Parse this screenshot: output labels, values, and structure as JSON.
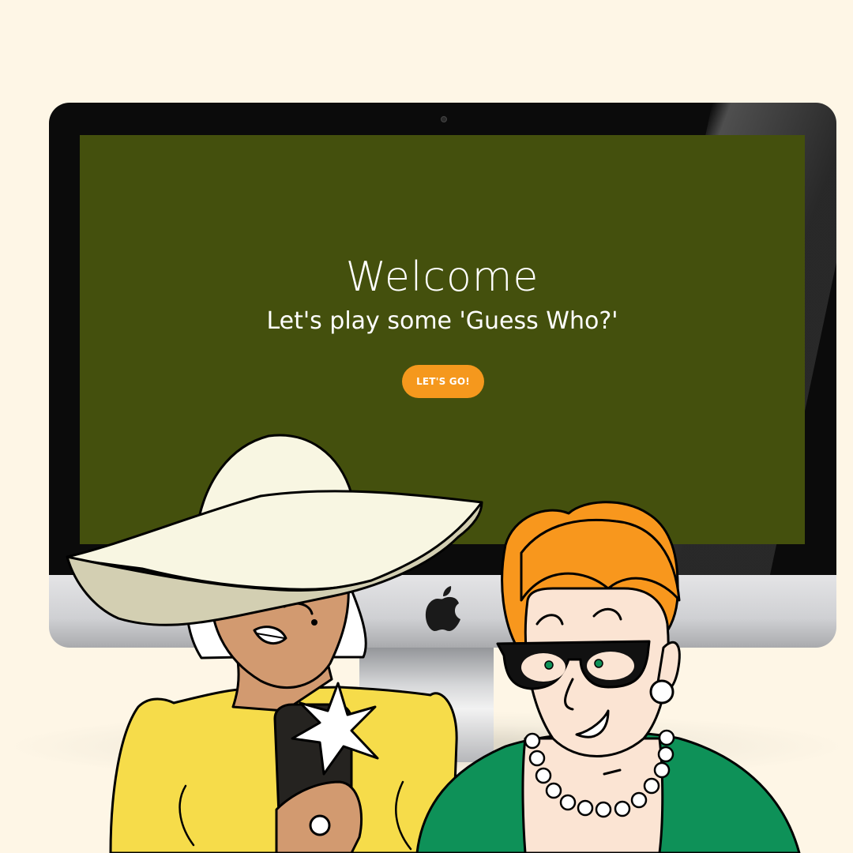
{
  "screen": {
    "title": "Welcome",
    "subtitle": "Let's play some 'Guess Who?'",
    "cta_label": "LET'S GO!"
  },
  "icons": {
    "monitor_brand": "apple-logo-icon",
    "phone_flash": "sparkle-icon"
  },
  "colors": {
    "page_background": "#FEF6E6",
    "screen_background": "#44500D",
    "cta_button": "#F5981D",
    "text": "#FFFFFF"
  }
}
